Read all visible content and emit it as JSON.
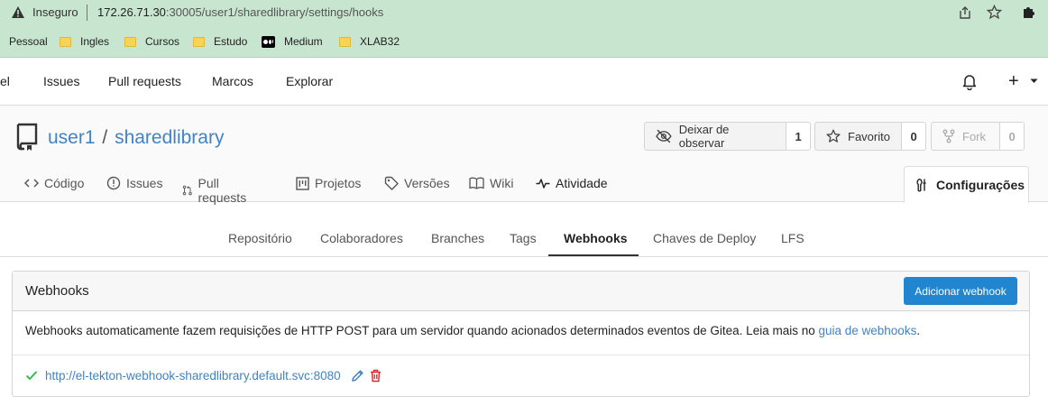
{
  "browser": {
    "security_label": "Inseguro",
    "url_host": "172.26.71.30",
    "url_rest": ":30005/user1/sharedlibrary/settings/hooks",
    "bookmarks": [
      {
        "label": "Pessoal",
        "icon": "none"
      },
      {
        "label": "Ingles",
        "icon": "folder-icon"
      },
      {
        "label": "Cursos",
        "icon": "folder-icon"
      },
      {
        "label": "Estudo",
        "icon": "folder-icon"
      },
      {
        "label": "Medium",
        "icon": "medium-icon"
      },
      {
        "label": "XLAB32",
        "icon": "folder-icon"
      }
    ]
  },
  "topnav": {
    "partial": "el",
    "items": [
      "Issues",
      "Pull requests",
      "Marcos",
      "Explorar"
    ],
    "plus": "+"
  },
  "repo": {
    "owner": "user1",
    "separator": "/",
    "name": "sharedlibrary",
    "watch": {
      "label": "Deixar de observar",
      "count": "1"
    },
    "star": {
      "label": "Favorito",
      "count": "0"
    },
    "fork": {
      "label": "Fork",
      "count": "0"
    }
  },
  "tabs": [
    {
      "label": "Código",
      "icon": "code-icon"
    },
    {
      "label": "Issues",
      "icon": "issue-icon"
    },
    {
      "label": "Pull requests",
      "icon": "pull-request-icon"
    },
    {
      "label": "Projetos",
      "icon": "project-icon"
    },
    {
      "label": "Versões",
      "icon": "tag-icon"
    },
    {
      "label": "Wiki",
      "icon": "book-icon"
    },
    {
      "label": "Atividade",
      "icon": "pulse-icon"
    }
  ],
  "active_tab": {
    "label": "Configurações",
    "icon": "tools-icon"
  },
  "settings_nav": {
    "items": [
      "Repositório",
      "Colaboradores",
      "Branches",
      "Tags",
      "Webhooks",
      "Chaves de Deploy",
      "LFS"
    ],
    "active": "Webhooks"
  },
  "webhooks": {
    "title": "Webhooks",
    "add_button": "Adicionar webhook",
    "description": "Webhooks automaticamente fazem requisições de HTTP POST para um servidor quando acionados determinados eventos de Gitea. Leia mais no ",
    "guide_link": "guia de webhooks",
    "description_end": ".",
    "hooks": [
      {
        "url": "http://el-tekton-webhook-sharedlibrary.default.svc:8080",
        "status": "success"
      }
    ]
  },
  "colors": {
    "accent": "#4183c4",
    "primary_button": "#2185d0",
    "success": "#21ba45",
    "danger": "#db2828",
    "browser_chrome": "#c8e5cf"
  }
}
